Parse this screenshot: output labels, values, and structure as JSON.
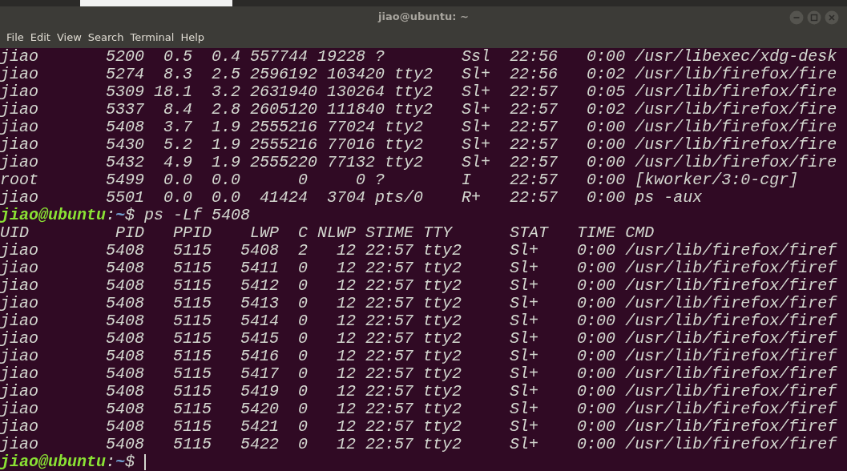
{
  "window": {
    "title": "jiao@ubuntu: ~"
  },
  "menu": [
    "File",
    "Edit",
    "View",
    "Search",
    "Terminal",
    "Help"
  ],
  "terminal": {
    "lines": [
      {
        "kind": "output",
        "text": "jiao       5200  0.5  0.4 557744 19228 ?        Ssl  22:56   0:00 /usr/libexec/xdg-desk"
      },
      {
        "kind": "output",
        "text": "jiao       5274  8.3  2.5 2596192 103420 tty2   Sl+  22:56   0:02 /usr/lib/firefox/fire"
      },
      {
        "kind": "output",
        "text": "jiao       5309 18.1  3.2 2631940 130264 tty2   Sl+  22:57   0:05 /usr/lib/firefox/fire"
      },
      {
        "kind": "output",
        "text": "jiao       5337  8.4  2.8 2605120 111840 tty2   Sl+  22:57   0:02 /usr/lib/firefox/fire"
      },
      {
        "kind": "output",
        "text": "jiao       5408  3.7  1.9 2555216 77024 tty2    Sl+  22:57   0:00 /usr/lib/firefox/fire"
      },
      {
        "kind": "output",
        "text": "jiao       5430  5.2  1.9 2555216 77016 tty2    Sl+  22:57   0:00 /usr/lib/firefox/fire"
      },
      {
        "kind": "output",
        "text": "jiao       5432  4.9  1.9 2555220 77132 tty2    Sl+  22:57   0:00 /usr/lib/firefox/fire"
      },
      {
        "kind": "output",
        "text": "root       5499  0.0  0.0      0     0 ?        I    22:57   0:00 [kworker/3:0-cgr]"
      },
      {
        "kind": "output",
        "text": "jiao       5501  0.0  0.0  41424  3704 pts/0    R+   22:57   0:00 ps -aux"
      },
      {
        "kind": "prompt",
        "user_host": "jiao@ubuntu",
        "colon": ":",
        "path": "~",
        "sign": "$",
        "command": "ps -Lf 5408",
        "cursor": false
      },
      {
        "kind": "output",
        "text": "UID         PID   PPID    LWP  C NLWP STIME TTY      STAT   TIME CMD"
      },
      {
        "kind": "output",
        "text": "jiao       5408   5115   5408  2   12 22:57 tty2     Sl+    0:00 /usr/lib/firefox/firef"
      },
      {
        "kind": "output",
        "text": "jiao       5408   5115   5411  0   12 22:57 tty2     Sl+    0:00 /usr/lib/firefox/firef"
      },
      {
        "kind": "output",
        "text": "jiao       5408   5115   5412  0   12 22:57 tty2     Sl+    0:00 /usr/lib/firefox/firef"
      },
      {
        "kind": "output",
        "text": "jiao       5408   5115   5413  0   12 22:57 tty2     Sl+    0:00 /usr/lib/firefox/firef"
      },
      {
        "kind": "output",
        "text": "jiao       5408   5115   5414  0   12 22:57 tty2     Sl+    0:00 /usr/lib/firefox/firef"
      },
      {
        "kind": "output",
        "text": "jiao       5408   5115   5415  0   12 22:57 tty2     Sl+    0:00 /usr/lib/firefox/firef"
      },
      {
        "kind": "output",
        "text": "jiao       5408   5115   5416  0   12 22:57 tty2     Sl+    0:00 /usr/lib/firefox/firef"
      },
      {
        "kind": "output",
        "text": "jiao       5408   5115   5417  0   12 22:57 tty2     Sl+    0:00 /usr/lib/firefox/firef"
      },
      {
        "kind": "output",
        "text": "jiao       5408   5115   5419  0   12 22:57 tty2     Sl+    0:00 /usr/lib/firefox/firef"
      },
      {
        "kind": "output",
        "text": "jiao       5408   5115   5420  0   12 22:57 tty2     Sl+    0:00 /usr/lib/firefox/firef"
      },
      {
        "kind": "output",
        "text": "jiao       5408   5115   5421  0   12 22:57 tty2     Sl+    0:00 /usr/lib/firefox/firef"
      },
      {
        "kind": "output",
        "text": "jiao       5408   5115   5422  0   12 22:57 tty2     Sl+    0:00 /usr/lib/firefox/firef"
      },
      {
        "kind": "prompt",
        "user_host": "jiao@ubuntu",
        "colon": ":",
        "path": "~",
        "sign": "$",
        "cursor": true
      }
    ]
  }
}
